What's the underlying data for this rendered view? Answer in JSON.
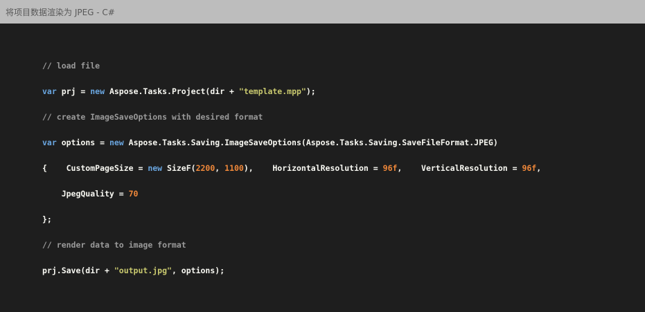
{
  "window": {
    "title": "将项目数据渲染为 JPEG - C#"
  },
  "code": {
    "comment_load": "// load file",
    "l2_var": "var",
    "l2_a": " prj = ",
    "l2_new": "new",
    "l2_b": " Aspose.Tasks.Project(dir + ",
    "l2_str": "\"template.mpp\"",
    "l2_c": ");",
    "comment_create": "// create ImageSaveOptions with desired format",
    "l4_var": "var",
    "l4_a": " options = ",
    "l4_new": "new",
    "l4_b": " Aspose.Tasks.Saving.ImageSaveOptions(Aspose.Tasks.Saving.SaveFileFormat.JPEG)",
    "l5_a": "{    CustomPageSize = ",
    "l5_new": "new",
    "l5_b": " SizeF(",
    "l5_n1": "2200",
    "l5_c": ", ",
    "l5_n2": "1100",
    "l5_d": "),    HorizontalResolution = ",
    "l5_n3": "96f",
    "l5_e": ",    VerticalResolution = ",
    "l5_n4": "96f",
    "l5_f": ",",
    "l6_a": "    JpegQuality = ",
    "l6_n": "70",
    "l7": "};",
    "comment_render": "// render data to image format",
    "l9_a": "prj.Save(dir + ",
    "l9_str": "\"output.jpg\"",
    "l9_b": ", options);"
  },
  "colors": {
    "titlebar": "#bdbdbd",
    "background": "#1e1e1e",
    "comment": "#9a9a9a",
    "keyword": "#6aa6e0",
    "string": "#c8c86e",
    "number": "#f0883a"
  }
}
